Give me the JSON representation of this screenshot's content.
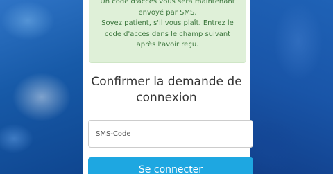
{
  "alert": {
    "lines": [
      "Un code d'accès vous sera maintenant",
      "envoyé par SMS.",
      "Soyez patient, s'il vous plaît. Entrez le",
      "code d'accès dans le champ suivant",
      "après l'avoir reçu."
    ],
    "color": "#3c763d",
    "background": "#dff0d8"
  },
  "title": {
    "lines": [
      "Confirmer la demande de",
      "connexion"
    ]
  },
  "sms_input": {
    "placeholder": "SMS-Code",
    "value": ""
  },
  "login_button": {
    "label": "Se connecter",
    "color": "#1ea7e1"
  }
}
